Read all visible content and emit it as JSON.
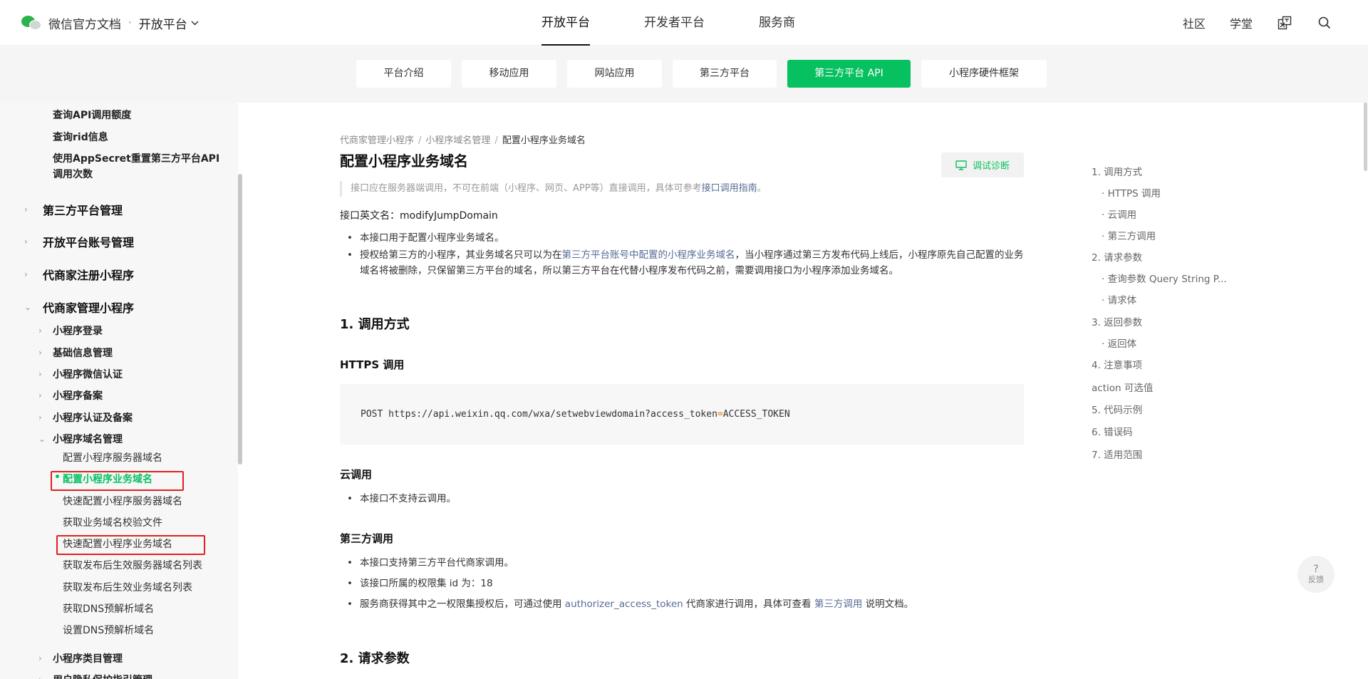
{
  "topnav": {
    "brand_title": "微信官方文档",
    "brand_dot": "·",
    "platform_label": "开放平台",
    "main_items": [
      "开放平台",
      "开发者平台",
      "服务商"
    ],
    "right_items": [
      "社区",
      "学堂"
    ],
    "icons": [
      "translate-icon",
      "search-icon"
    ]
  },
  "subnav": {
    "tabs": [
      "平台介绍",
      "移动应用",
      "网站应用",
      "第三方平台",
      "第三方平台 API",
      "小程序硬件框架"
    ],
    "active": "第三方平台 API"
  },
  "sidebar": {
    "top_leaves": [
      "查询API调用额度",
      "查询rid信息",
      "使用AppSecret重置第三方平台API",
      "调用次数"
    ],
    "sections": [
      "第三方平台管理",
      "开放平台账号管理",
      "代商家注册小程序",
      "代商家管理小程序"
    ],
    "subsections": [
      "小程序登录",
      "基础信息管理",
      "小程序微信认证",
      "小程序备案",
      "小程序认证及备案",
      "小程序域名管理"
    ],
    "items": [
      "配置小程序服务器域名",
      "配置小程序业务域名",
      "快速配置小程序服务器域名",
      "获取业务域名校验文件",
      "快速配置小程序业务域名",
      "获取发布后生效服务器域名列表",
      "获取发布后生效业务域名列表",
      "获取DNS预解析域名",
      "设置DNS预解析域名"
    ],
    "bottom_subsections": [
      "小程序类目管理",
      "用户隐私保护指引管理"
    ]
  },
  "content": {
    "breadcrumb": [
      "代商家管理小程序",
      "小程序域名管理",
      "配置小程序业务域名"
    ],
    "title": "配置小程序业务域名",
    "debug_button": "调试诊断",
    "notice_text": "接口应在服务器端调用，不可在前端（小程序、网页、APP等）直接调用，具体可参考",
    "notice_link": "接口调用指南",
    "notice_end": "。",
    "api_name": "接口英文名：modifyJumpDomain",
    "intro": {
      "b1": "本接口用于配置小程序业务域名。",
      "b2_pre": "授权给第三方的小程序，其业务域名只可以为在",
      "b2_link": "第三方平台账号中配置的小程序业务域名",
      "b2_post": "，当小程序通过第三方发布代码上线后，小程序原先自己配置的业务域名将被删除，只保留第三方平台的域名，所以第三方平台在代替小程序发布代码之前，需要调用接口为小程序添加业务域名。"
    },
    "h_call": "1. 调用方式",
    "h_https": "HTTPS 调用",
    "code_pre": "POST https://api.weixin.qq.com/wxa/setwebviewdomain?access_token",
    "code_eq": "=",
    "code_post": "ACCESS_TOKEN",
    "h_cloud": "云调用",
    "cloud_b1": "本接口不支持云调用。",
    "h_third": "第三方调用",
    "third_b1": "本接口支持第三方平台代商家调用。",
    "third_b2": "该接口所属的权限集 id 为：18",
    "third_b3_pre": "服务商获得其中之一权限集授权后，可通过使用",
    "third_b3_link1": "authorizer_access_token",
    "third_b3_mid": "代商家进行调用，具体可查看",
    "third_b3_link2": "第三方调用",
    "third_b3_post": "说明文档。",
    "h_params": "2. 请求参数"
  },
  "toc": [
    "1. 调用方式",
    "· HTTPS 调用",
    "· 云调用",
    "· 第三方调用",
    "2. 请求参数",
    "· 查询参数 Query String P...",
    "· 请求体",
    "3. 返回参数",
    "· 返回体",
    "4. 注意事项",
    "action 可选值",
    "5. 代码示例",
    "6. 错误码",
    "7. 适用范围"
  ],
  "feedback": {
    "q": "?",
    "label": "反馈"
  },
  "colors": {
    "brand_green": "#07c160",
    "link": "#576b95",
    "highlight_box": "#e02020"
  }
}
